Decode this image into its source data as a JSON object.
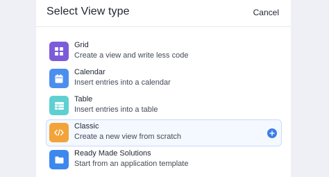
{
  "dialog": {
    "title": "Select View type",
    "cancel_label": "Cancel"
  },
  "items": [
    {
      "label": "Grid",
      "desc": "Create a view and write less code",
      "icon": "grid-icon",
      "color": "#7c5cd9"
    },
    {
      "label": "Calendar",
      "desc": "Insert entries into a calendar",
      "icon": "calendar-icon",
      "color": "#4c8ef0"
    },
    {
      "label": "Table",
      "desc": "Insert entries into a table",
      "icon": "table-icon",
      "color": "#5fd0d2"
    },
    {
      "label": "Classic",
      "desc": "Create a new view from scratch",
      "icon": "code-icon",
      "color": "#f2a33a",
      "selected": true
    },
    {
      "label": "Ready Made Solutions",
      "desc": "Start from an application template",
      "icon": "folder-icon",
      "color": "#3d88ef"
    }
  ],
  "colors": {
    "accent": "#3c7ee8",
    "selected_bg": "#f4f8ff"
  }
}
